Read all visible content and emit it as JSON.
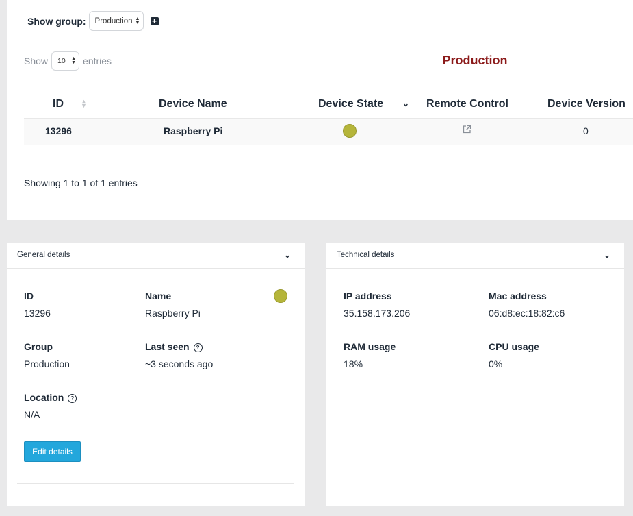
{
  "group_selector": {
    "label": "Show group:",
    "selected": "Production"
  },
  "entries": {
    "prefix": "Show",
    "value": "10",
    "suffix": "entries"
  },
  "table": {
    "title": "Production",
    "columns": [
      "ID",
      "Device Name",
      "Device State",
      "Remote Control",
      "Device Version"
    ],
    "rows": [
      {
        "id": "13296",
        "name": "Raspberry Pi",
        "state_color": "#b5b53a",
        "version": "0"
      }
    ],
    "footer": "Showing 1 to 1 of 1 entries"
  },
  "general_details": {
    "title": "General details",
    "id_label": "ID",
    "id_value": "13296",
    "name_label": "Name",
    "name_value": "Raspberry Pi",
    "group_label": "Group",
    "group_value": "Production",
    "last_seen_label": "Last seen",
    "last_seen_value": "~3 seconds ago",
    "location_label": "Location",
    "location_value": "N/A",
    "edit_button": "Edit details"
  },
  "technical_details": {
    "title": "Technical details",
    "ip_label": "IP address",
    "ip_value": "35.158.173.206",
    "mac_label": "Mac address",
    "mac_value": "06:d8:ec:18:82:c6",
    "ram_label": "RAM usage",
    "ram_value": "18%",
    "cpu_label": "CPU usage",
    "cpu_value": "0%"
  },
  "colors": {
    "accent_title": "#8b1a1a",
    "button": "#23a7dc",
    "status_online": "#b5b53a"
  }
}
